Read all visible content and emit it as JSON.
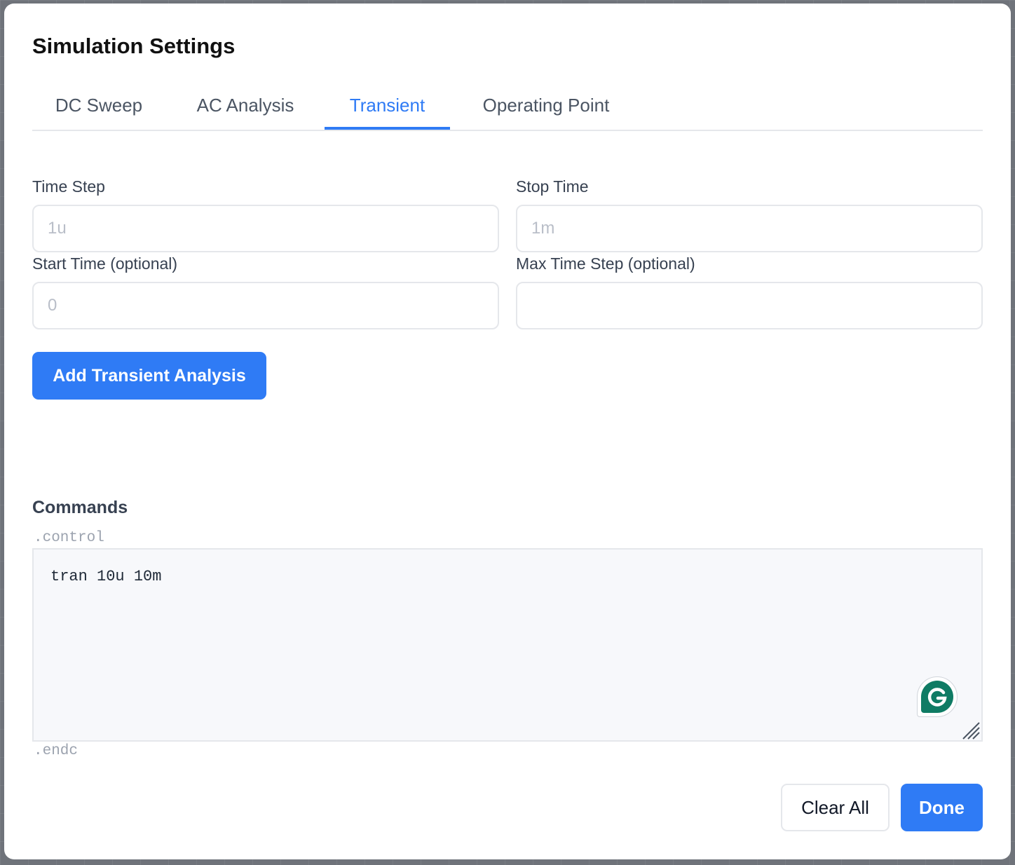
{
  "dialog": {
    "title": "Simulation Settings"
  },
  "tabs": [
    {
      "label": "DC Sweep",
      "active": false
    },
    {
      "label": "AC Analysis",
      "active": false
    },
    {
      "label": "Transient",
      "active": true
    },
    {
      "label": "Operating Point",
      "active": false
    }
  ],
  "transient_form": {
    "time_step": {
      "label": "Time Step",
      "value": "",
      "placeholder": "1u"
    },
    "stop_time": {
      "label": "Stop Time",
      "value": "",
      "placeholder": "1m"
    },
    "start_time": {
      "label": "Start Time (optional)",
      "value": "",
      "placeholder": "0"
    },
    "max_time_step": {
      "label": "Max Time Step (optional)",
      "value": "",
      "placeholder": ""
    },
    "add_button_label": "Add Transient Analysis"
  },
  "commands": {
    "title": "Commands",
    "prefix": ".control",
    "text": "tran 10u 10m",
    "suffix": ".endc"
  },
  "footer": {
    "clear_label": "Clear All",
    "done_label": "Done"
  },
  "colors": {
    "accent": "#2f7bf5",
    "grammarly_badge": "#0f7b64"
  }
}
